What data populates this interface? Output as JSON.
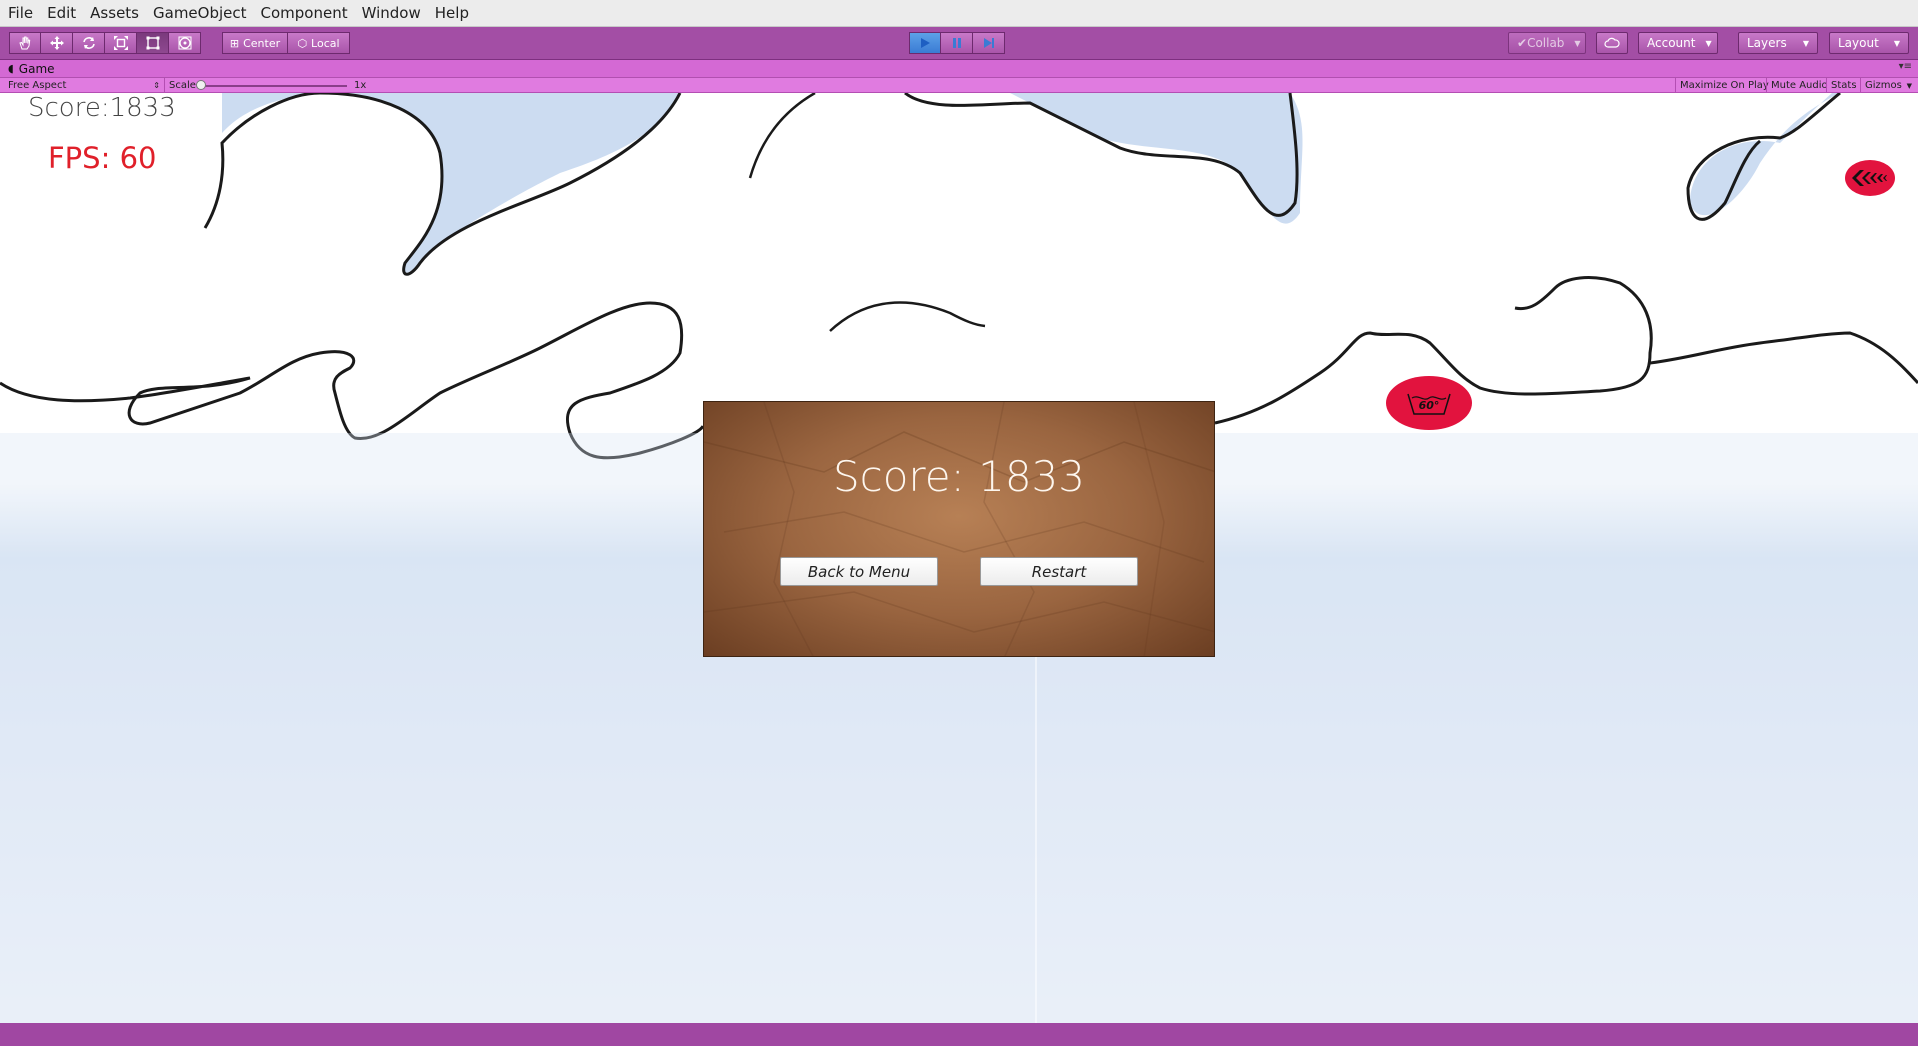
{
  "menubar": {
    "items": [
      "File",
      "Edit",
      "Assets",
      "GameObject",
      "Component",
      "Window",
      "Help"
    ]
  },
  "toolbar": {
    "tools": [
      "hand-tool",
      "move-tool",
      "rotate-tool",
      "scale-tool",
      "rect-tool",
      "transform-tool"
    ],
    "pivot_label": "Center",
    "space_label": "Local",
    "collab_label": "Collab",
    "account_label": "Account",
    "layers_label": "Layers",
    "layout_label": "Layout"
  },
  "game_tab": {
    "title": "Game"
  },
  "game_bar": {
    "aspect": "Free Aspect",
    "scale_label": "Scale",
    "scale_value": "1x",
    "scale_fraction": 0,
    "maximize_label": "Maximize On Play",
    "mute_label": "Mute Audio",
    "stats_label": "Stats",
    "gizmos_label": "Gizmos"
  },
  "hud": {
    "score_text": "Score:1833",
    "fps_text": "FPS: 60"
  },
  "enemies": [
    {
      "label": "",
      "icon": "chevrons-left-icon"
    },
    {
      "label": "60°",
      "icon": "washing-tub-icon"
    }
  ],
  "dialog": {
    "score_text": "Score: 1833",
    "back_label": "Back to Menu",
    "restart_label": "Restart"
  },
  "colors": {
    "editor_accent": "#a34ea5",
    "fps_color": "#e0202a",
    "enemy_color": "#e2133e"
  }
}
